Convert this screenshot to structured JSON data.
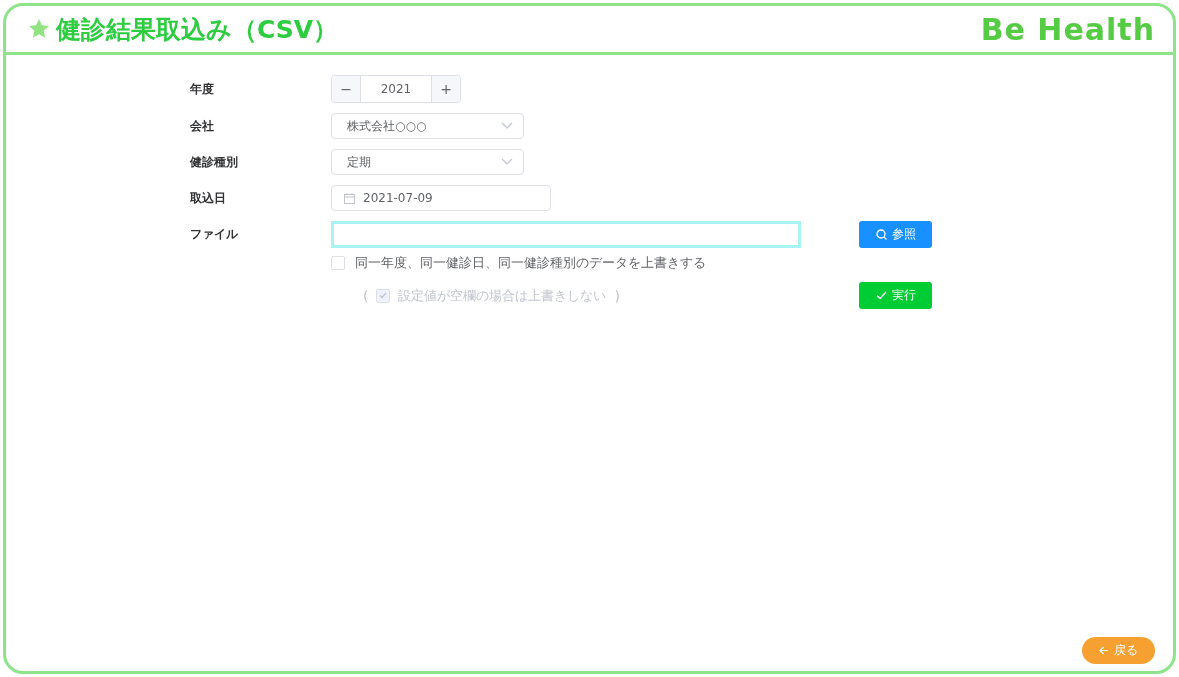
{
  "header": {
    "title": "健診結果取込み（CSV）",
    "logo": "Be Health"
  },
  "form": {
    "year": {
      "label": "年度",
      "minus": "−",
      "value": "2021",
      "plus": "+"
    },
    "company": {
      "label": "会社",
      "value": "株式会社○○○"
    },
    "exam_type": {
      "label": "健診種別",
      "value": "定期"
    },
    "import_date": {
      "label": "取込日",
      "value": "2021-07-09"
    },
    "file": {
      "label": "ファイル",
      "focused": true
    },
    "browse_button": "参照",
    "overwrite": {
      "label": "同一年度、同一健診日、同一健診種別のデータを上書きする",
      "checked": false,
      "disabled": false
    },
    "blank_option": {
      "open": "(",
      "label": "設定値が空欄の場合は上書きしない",
      "close": ")",
      "checked": true,
      "disabled": true
    },
    "run_button": "実行"
  },
  "back_button": "戻る"
}
